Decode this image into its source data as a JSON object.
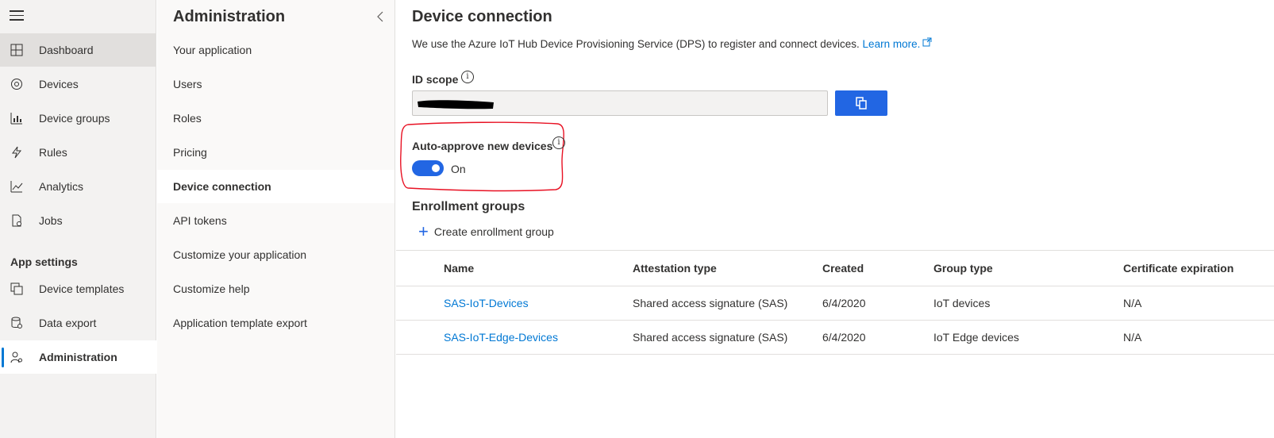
{
  "nav": {
    "items": [
      {
        "label": "Dashboard",
        "icon": "dashboard-icon"
      },
      {
        "label": "Devices",
        "icon": "devices-icon"
      },
      {
        "label": "Device groups",
        "icon": "device-groups-icon"
      },
      {
        "label": "Rules",
        "icon": "rules-icon"
      },
      {
        "label": "Analytics",
        "icon": "analytics-icon"
      },
      {
        "label": "Jobs",
        "icon": "jobs-icon"
      }
    ],
    "section_label": "App settings",
    "settings_items": [
      {
        "label": "Device templates",
        "icon": "device-templates-icon"
      },
      {
        "label": "Data export",
        "icon": "data-export-icon"
      },
      {
        "label": "Administration",
        "icon": "administration-icon"
      }
    ]
  },
  "admin": {
    "title": "Administration",
    "items": [
      {
        "label": "Your application"
      },
      {
        "label": "Users"
      },
      {
        "label": "Roles"
      },
      {
        "label": "Pricing"
      },
      {
        "label": "Device connection"
      },
      {
        "label": "API tokens"
      },
      {
        "label": "Customize your application"
      },
      {
        "label": "Customize help"
      },
      {
        "label": "Application template export"
      }
    ]
  },
  "main": {
    "title": "Device connection",
    "description": "We use the Azure IoT Hub Device Provisioning Service (DPS) to register and connect devices.",
    "learn_more": "Learn more.",
    "id_scope_label": "ID scope",
    "auto_approve_label": "Auto-approve new devices",
    "toggle_state": "On",
    "enrollment_title": "Enrollment groups",
    "create_label": "Create enrollment group",
    "table": {
      "headers": [
        "Name",
        "Attestation type",
        "Created",
        "Group type",
        "Certificate expiration"
      ],
      "rows": [
        [
          "SAS-IoT-Devices",
          "Shared access signature (SAS)",
          "6/4/2020",
          "IoT devices",
          "N/A"
        ],
        [
          "SAS-IoT-Edge-Devices",
          "Shared access signature (SAS)",
          "6/4/2020",
          "IoT Edge devices",
          "N/A"
        ]
      ]
    }
  },
  "colors": {
    "accent": "#2266e3",
    "link": "#0078d4",
    "annotation": "#e81123"
  }
}
